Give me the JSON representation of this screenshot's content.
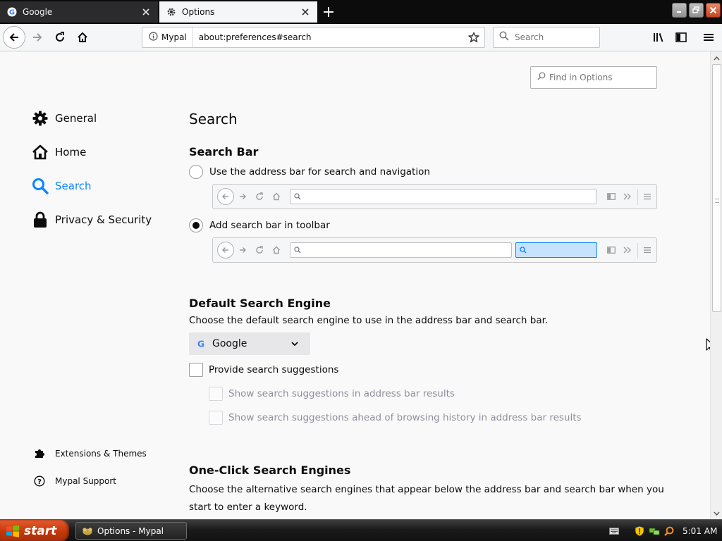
{
  "tabs": [
    {
      "title": "Google",
      "active": false
    },
    {
      "title": "Options",
      "active": true
    }
  ],
  "navbar": {
    "identity_label": "Mypal",
    "url": "about:preferences#search",
    "search_placeholder": "Search"
  },
  "sidebar": {
    "categories": [
      {
        "label": "General",
        "icon": "gear-icon"
      },
      {
        "label": "Home",
        "icon": "home-icon"
      },
      {
        "label": "Search",
        "icon": "search-icon",
        "selected": true
      },
      {
        "label": "Privacy & Security",
        "icon": "lock-icon"
      }
    ],
    "footer": {
      "addons": "Extensions & Themes",
      "support": "Mypal Support"
    }
  },
  "find_placeholder": "Find in Options",
  "main": {
    "title": "Search",
    "search_bar": {
      "heading": "Search Bar",
      "option_urlbar": "Use the address bar for search and navigation",
      "option_searchbar": "Add search bar in toolbar",
      "selected": "option_searchbar"
    },
    "default_engine": {
      "heading": "Default Search Engine",
      "description": "Choose the default search engine to use in the address bar and search bar.",
      "selected_engine": "Google",
      "provide_suggestions": "Provide search suggestions",
      "suggestions_in_urlbar": "Show search suggestions in address bar results",
      "suggestions_ahead": "Show search suggestions ahead of browsing history in address bar results"
    },
    "one_click": {
      "heading": "One-Click Search Engines",
      "description": "Choose the alternative search engines that appear below the address bar and search bar when you start to enter a keyword."
    }
  },
  "taskbar": {
    "start_label": "start",
    "task_label": "Options - Mypal",
    "clock": "5:01 AM"
  },
  "colors": {
    "accent": "#0a84ff",
    "text": "#0c0c0d",
    "disabled_text": "#8f8f9d",
    "page_bg": "#f9f9fa"
  }
}
